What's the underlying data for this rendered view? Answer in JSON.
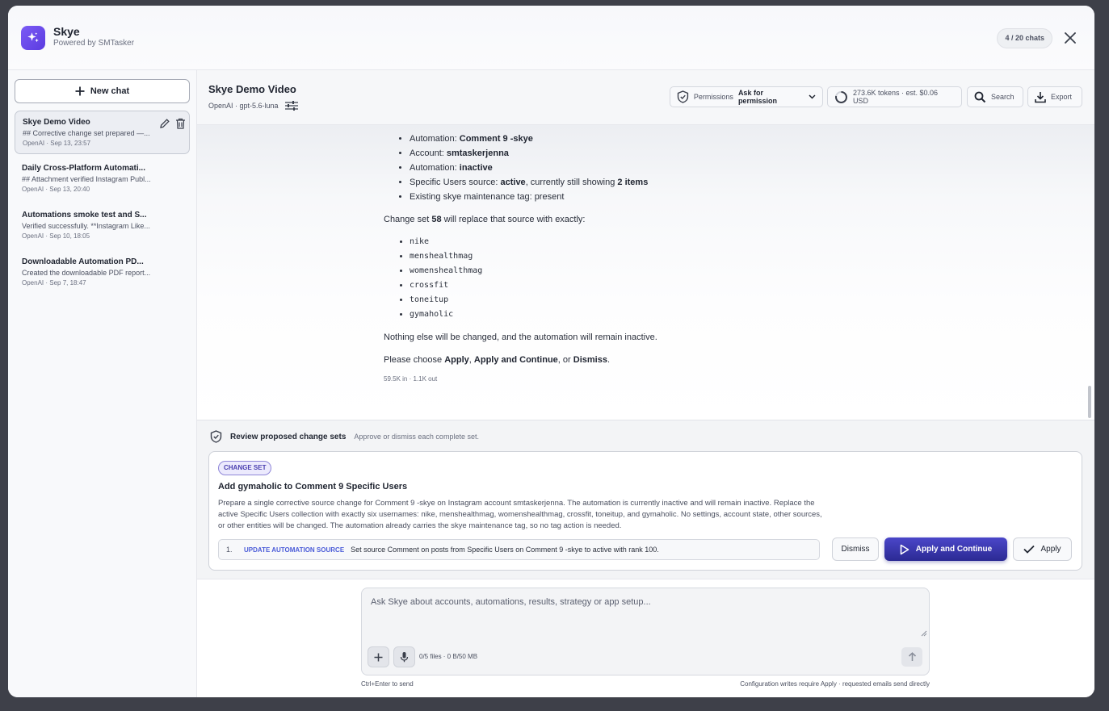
{
  "app": {
    "title": "Skye",
    "subtitle": "Powered by SMTasker",
    "chat_count": "4 / 20 chats",
    "accent": "#5b3be0"
  },
  "sidebar": {
    "new_chat_label": "New chat",
    "chats": [
      {
        "title": "Skye Demo Video",
        "preview": "## Corrective change set prepared —...",
        "meta": "OpenAI · Sep 13, 23:57",
        "active": true
      },
      {
        "title": "Daily Cross-Platform Automati...",
        "preview": "## Attachment verified Instagram Publ...",
        "meta": "OpenAI · Sep 13, 20:40",
        "active": false
      },
      {
        "title": "Automations smoke test and S...",
        "preview": "Verified successfully. **Instagram Like...",
        "meta": "OpenAI · Sep 10, 18:05",
        "active": false
      },
      {
        "title": "Downloadable Automation PD...",
        "preview": "Created the downloadable PDF report...",
        "meta": "OpenAI · Sep 7, 18:47",
        "active": false
      }
    ]
  },
  "header": {
    "title": "Skye Demo Video",
    "model": "OpenAI · gpt-5.6-luna",
    "permissions_label": "Permissions",
    "permissions_value": "Ask for permission",
    "tokens": "273.6K tokens · est. $0.06 USD",
    "search_label": "Search",
    "export_label": "Export"
  },
  "message": {
    "bullets": [
      {
        "label": "Automation: ",
        "value": "Comment 9 -skye",
        "rest": ""
      },
      {
        "label": "Account: ",
        "value": "smtaskerjenna",
        "rest": ""
      },
      {
        "label": "Automation: ",
        "value": "inactive",
        "rest": ""
      },
      {
        "label": "Specific Users source: ",
        "value": "active",
        "rest": ", currently still showing ",
        "value2": "2 items"
      },
      {
        "label": "Existing skye maintenance tag: present",
        "value": "",
        "rest": ""
      }
    ],
    "change_intro_pre": "Change set ",
    "change_intro_num": "58",
    "change_intro_post": " will replace that source with exactly:",
    "usernames": [
      "nike",
      "menshealthmag",
      "womenshealthmag",
      "crossfit",
      "toneitup",
      "gymaholic"
    ],
    "nothing_else": "Nothing else will be changed, and the automation will remain inactive.",
    "choose_pre": "Please choose ",
    "choose_apply": "Apply",
    "choose_sep1": ", ",
    "choose_apply_continue": "Apply and Continue",
    "choose_sep2": ", or ",
    "choose_dismiss": "Dismiss",
    "choose_end": ".",
    "token_usage": "59.5K in · 1.1K out"
  },
  "review": {
    "title": "Review proposed change sets",
    "subtitle": "Approve or dismiss each complete set.",
    "badge": "CHANGE SET",
    "card_title": "Add gymaholic to Comment 9 Specific Users",
    "description": "Prepare a single corrective source change for Comment 9 -skye on Instagram account smtaskerjenna. The automation is currently inactive and will remain inactive. Replace the active Specific Users collection with exactly six usernames: nike, menshealthmag, womenshealthmag, crossfit, toneitup, and gymaholic. No settings, account state, other sources, or other entities will be changed. The automation already carries the skye maintenance tag, so no tag action is needed.",
    "step_number": "1.",
    "step_type": "UPDATE AUTOMATION SOURCE",
    "step_text": "Set source Comment on posts from Specific Users on Comment 9 -skye to active with rank 100.",
    "dismiss_label": "Dismiss",
    "apply_continue_label": "Apply and Continue",
    "apply_label": "Apply"
  },
  "composer": {
    "placeholder": "Ask Skye about accounts, automations, results, strategy or app setup...",
    "files_info": "0/5 files · 0 B/50 MB",
    "hint_left": "Ctrl+Enter to send",
    "hint_right": "Configuration writes require Apply · requested emails send directly"
  }
}
